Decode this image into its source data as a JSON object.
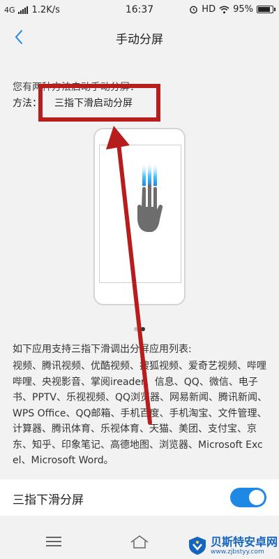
{
  "status_bar": {
    "network": "4G",
    "speed": "1.2K/s",
    "time": "16:37",
    "hd": "HD",
    "battery_percent": "95%",
    "battery_level": 0.95
  },
  "header": {
    "title": "手动分屏",
    "back_icon": "chevron-left-icon"
  },
  "content": {
    "intro": "您有两种方法启动手动分屏：",
    "method_label": "方法：",
    "method_value": "三指下滑启动分屏",
    "illustration_icon": "three-finger-swipe-hand-icon",
    "page_count": 2,
    "page_active": 2,
    "apps_title": "如下应用支持三指下滑调出分屏应用列表:",
    "apps_list": "视频、腾讯视频、优酷视频、搜狐视频、爱奇艺视频、哔哩哔哩、央视影音、掌阅ireader、信息、QQ、微信、电子书、PPTV、乐视视频、QQ浏览器、网易新闻、腾讯新闻、WPS Office、QQ邮箱、手机百度、手机淘宝、文件管理、计算器、腾讯体育、乐视体育、天猫、美团、支付宝、京东、知乎、印象笔记、高德地图、浏览器、Microsoft Excel、Microsoft Word。"
  },
  "setting": {
    "label": "三指下滑分屏",
    "enabled": true
  },
  "nav": {
    "menu_icon": "menu-icon",
    "home_icon": "home-icon"
  },
  "watermark": {
    "name": "贝斯特安卓网",
    "url": "www.zjbstyy.com"
  },
  "colors": {
    "accent": "#1e88e5",
    "annotation": "#b81d1d",
    "background": "#f2f2f2"
  }
}
